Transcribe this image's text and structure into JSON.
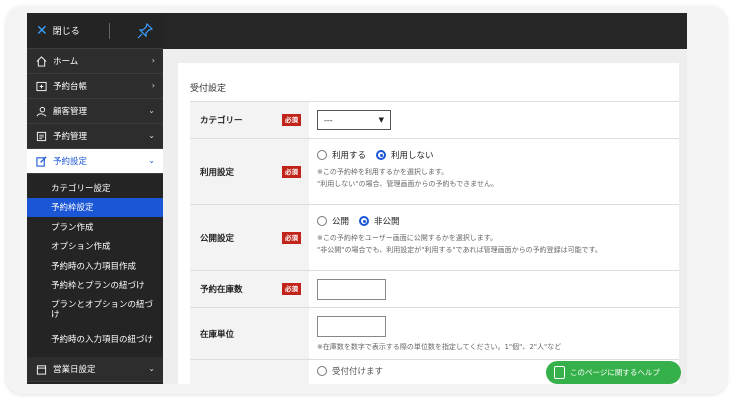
{
  "sidebar": {
    "close_label": "閉じる",
    "menu": [
      {
        "label": "ホーム",
        "chevron": "›",
        "icon": "home-icon"
      },
      {
        "label": "予約台帳",
        "chevron": "›",
        "icon": "ledger-icon"
      },
      {
        "label": "顧客管理",
        "chevron": "⌄",
        "icon": "customer-icon"
      },
      {
        "label": "予約管理",
        "chevron": "⌄",
        "icon": "reservation-icon"
      },
      {
        "label": "予約設定",
        "chevron": "⌄",
        "icon": "edit-icon"
      }
    ],
    "sub_items": [
      {
        "label": "カテゴリー設定"
      },
      {
        "label": "予約枠設定"
      },
      {
        "label": "プラン作成"
      },
      {
        "label": "オプション作成"
      },
      {
        "label": "予約時の入力項目作成"
      },
      {
        "label": "予約枠とプランの紐づけ"
      },
      {
        "label": "プランとオプションの紐づけ"
      },
      {
        "label": "予約時の入力項目の紐づけ"
      }
    ],
    "bottom_item": {
      "label": "営業日設定",
      "chevron": "⌄"
    }
  },
  "card": {
    "title": "受付設定"
  },
  "form": {
    "required_badge": "必須",
    "category": {
      "label": "カテゴリー",
      "select_value": "---"
    },
    "usage": {
      "label": "利用設定",
      "option_use": "利用する",
      "option_not_use": "利用しない",
      "selected": "利用しない",
      "note1": "※この予約枠を利用するかを選択します。",
      "note2": "\"利用しない\"の場合、管理画面からの予約もできません。"
    },
    "publish": {
      "label": "公開設定",
      "option_public": "公開",
      "option_private": "非公開",
      "selected": "非公開",
      "note1": "※この予約枠をユーザー画面に公開するかを選択します。",
      "note2": "\"非公開\"の場合でも、利用設定が\"利用する\"であれば管理画面からの予約登録は可能です。"
    },
    "stock": {
      "label": "予約在庫数",
      "value": ""
    },
    "stock_unit": {
      "label": "在庫単位",
      "value": "",
      "note": "※在庫数を数字で表示する際の単位数を指定してください。1\"個\"、2\"人\"など"
    },
    "partial_radio_label": "受付付けます"
  },
  "help_button": {
    "label": "このページに関するヘルプ"
  },
  "colors": {
    "accent": "#1a56d6",
    "required": "#c0241a",
    "help": "#36b04a",
    "sidebar": "#242424"
  }
}
